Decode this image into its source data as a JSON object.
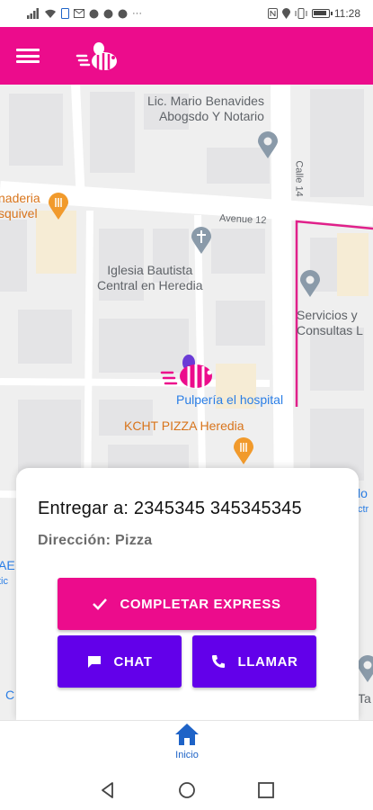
{
  "status_bar": {
    "time": "11:28"
  },
  "app_bar": {
    "menu_icon": "hamburger-menu-icon",
    "logo": "bee-logo"
  },
  "map": {
    "labels": {
      "law_office": "Lic. Mario Benavides\nAbogsdo Y Notario",
      "bakery": "naderia\nsquivel",
      "street_avenue": "Avenue 12",
      "street_calle": "Calle 14",
      "church": "Iglesia Bautista\nCentral en Heredia",
      "services": "Servicios y\nConsultas L",
      "pulperia": "Pulpería el hospital",
      "pizza": "KCHT PIZZA Heredia",
      "edge_lo": "lo",
      "edge_ctr": "ctr",
      "edge_ae": "AE",
      "edge_tic": "tic",
      "edge_c": "C",
      "edge_ta": "Ta"
    }
  },
  "card": {
    "deliver_title": "Entregar a: 2345345 345345345",
    "address": "Dirección: Pizza",
    "complete_label": "COMPLETAR EXPRESS",
    "chat_label": "CHAT",
    "call_label": "LLAMAR"
  },
  "bottom_nav": {
    "home_label": "Inicio"
  },
  "colors": {
    "brand_pink": "#ec0c8c",
    "brand_purple": "#6200ea",
    "nav_blue": "#1e63c7"
  }
}
